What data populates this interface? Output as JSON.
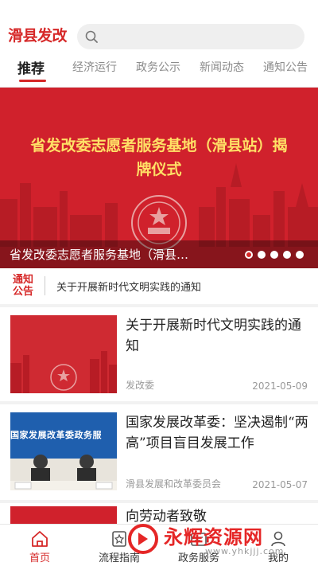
{
  "header": {
    "logo": "滑县发改",
    "search_placeholder": ""
  },
  "tabs": [
    {
      "label": "推荐",
      "active": true
    },
    {
      "label": "经济运行"
    },
    {
      "label": "政务公示"
    },
    {
      "label": "新闻动态"
    },
    {
      "label": "通知公告"
    }
  ],
  "banner": {
    "headline": "省发改委志愿者服务基地（滑县站）揭牌仪式",
    "caption": "省发改委志愿者服务基地（滑县…",
    "slide_count": 5,
    "active_slide": 1
  },
  "notice": {
    "badge": "通知公告",
    "text": "关于开展新时代文明实践的通知"
  },
  "news": [
    {
      "title": "关于开展新时代文明实践的通知",
      "source": "发改委",
      "date": "2021-05-09"
    },
    {
      "title": "国家发展改革委：坚决遏制“两高”项目盲目发展工作",
      "source": "滑县发展和改革委员会",
      "date": "2021-05-07",
      "thumb_banner": "国家发展改革委政务服"
    },
    {
      "title": "向劳动者致敬"
    }
  ],
  "bottom_nav": [
    {
      "label": "首页",
      "icon": "home-icon",
      "active": true
    },
    {
      "label": "流程指南",
      "icon": "guide-icon"
    },
    {
      "label": "政务服务",
      "icon": "service-icon"
    },
    {
      "label": "我的",
      "icon": "user-icon"
    }
  ],
  "watermark": {
    "title": "永辉资源网",
    "url": "www.yhkjjj.com"
  },
  "colors": {
    "brand": "#d62828",
    "banner_bg": "#d0212c",
    "headline": "#ffe066"
  }
}
